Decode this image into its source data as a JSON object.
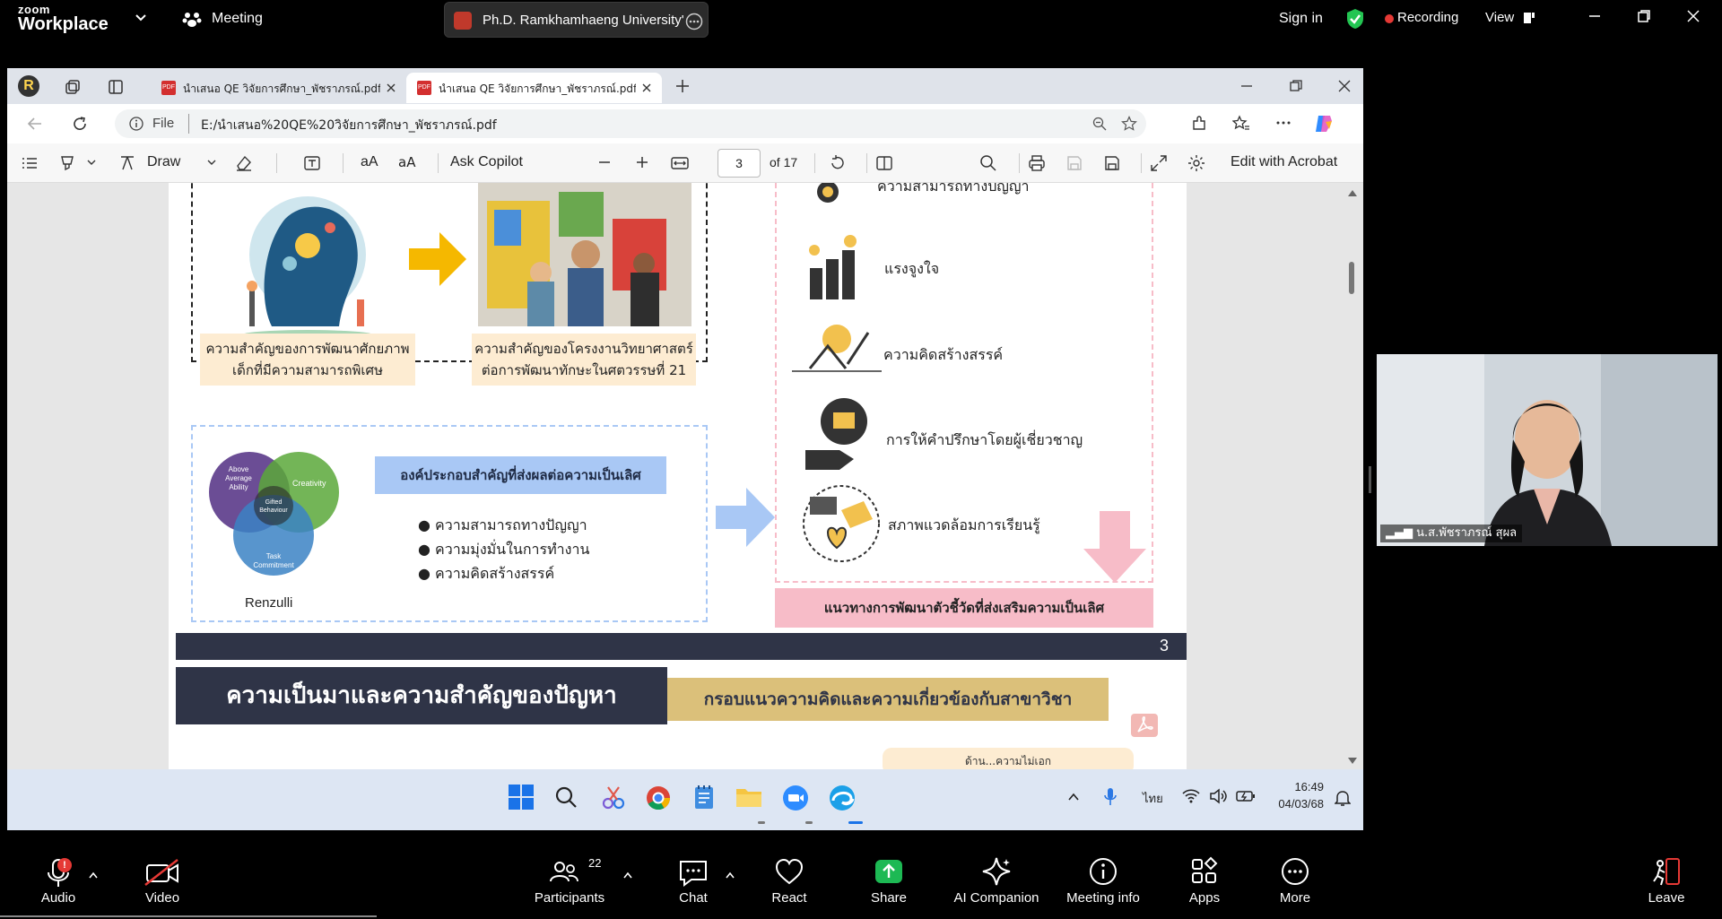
{
  "zoom": {
    "logo_top": "zoom",
    "logo_bottom": "Workplace",
    "meeting_menu": "Meeting",
    "meeting_title": "Ph.D. Ramkhamhaeng University'",
    "sign_in": "Sign in",
    "recording": "Recording",
    "view": "View"
  },
  "browser": {
    "tabs": [
      {
        "title": "นำเสนอ QE วิจัยการศึกษา_พัชราภรณ์.pdf"
      },
      {
        "title": "นำเสนอ QE วิจัยการศึกษา_พัชราภรณ์.pdf"
      }
    ],
    "url_prefix": "File",
    "url": "E:/นำเสนอ%20QE%20วิจัยการศึกษา_พัชราภรณ์.pdf"
  },
  "pdf_toolbar": {
    "draw": "Draw",
    "ask_copilot": "Ask Copilot",
    "page_current": "3",
    "page_total": "of 17",
    "edit_acrobat": "Edit with Acrobat",
    "aa": " аА",
    "read_aloud": "aA"
  },
  "slide": {
    "caption_left": [
      "ความสำคัญของการพัฒนาศักยภาพ",
      "เด็กที่มีความสามารถพิเศษ"
    ],
    "caption_right": [
      "ความสำคัญของโครงงานวิทยาศาสตร์",
      "ต่อการพัฒนาทักษะในศตวรรษที่ 21"
    ],
    "venn": {
      "above": [
        "Above",
        "Average",
        "Ability"
      ],
      "creativity": "Creativity",
      "task": [
        "Task",
        "Commitment"
      ],
      "center": [
        "Gifted",
        "Behaviour"
      ],
      "author": "Renzulli"
    },
    "components_title": "องค์ประกอบสำคัญที่ส่งผลต่อความเป็นเลิศ",
    "bullets": [
      "ความสามารถทางปัญญา",
      "ความมุ่งมั่นในการทำงาน",
      "ความคิดสร้างสรรค์"
    ],
    "right_items": [
      "ความสามารถทางปัญญา",
      "แรงจูงใจ",
      "ความคิดสร้างสรรค์",
      "การให้คำปรึกษาโดยผู้เชี่ยวชาญ",
      "สภาพแวดล้อมการเรียนรู้"
    ],
    "right_banner": "แนวทางการพัฒนาตัวชี้วัดที่ส่งเสริมความเป็นเลิศ",
    "page_number": "3",
    "next_title": "ความเป็นมาและความสำคัญของปัญหา",
    "next_subtitle": "กรอบแนวความคิดและความเกี่ยวข้องกับสาขาวิชา",
    "partial_box": "ด้าน...ความไม่เอก"
  },
  "taskbar": {
    "lang": "ไทย",
    "time": "16:49",
    "date": "04/03/68"
  },
  "video": {
    "participant": "น.ส.พัชราภรณ์ สุผล"
  },
  "controls": {
    "audio": "Audio",
    "video": "Video",
    "participants": "Participants",
    "participants_count": "22",
    "chat": "Chat",
    "react": "React",
    "share": "Share",
    "ai": "AI Companion",
    "info": "Meeting info",
    "apps": "Apps",
    "more": "More",
    "leave": "Leave",
    "audio_badge": "!"
  },
  "colors": {
    "navy": "#2f3447",
    "gold": "#dbc07a",
    "blue_box": "#a9c8f5",
    "pink": "#f7bcc8",
    "caption_bg": "#fdecd2",
    "recording_red": "#e53935",
    "share_green": "#1db954"
  }
}
